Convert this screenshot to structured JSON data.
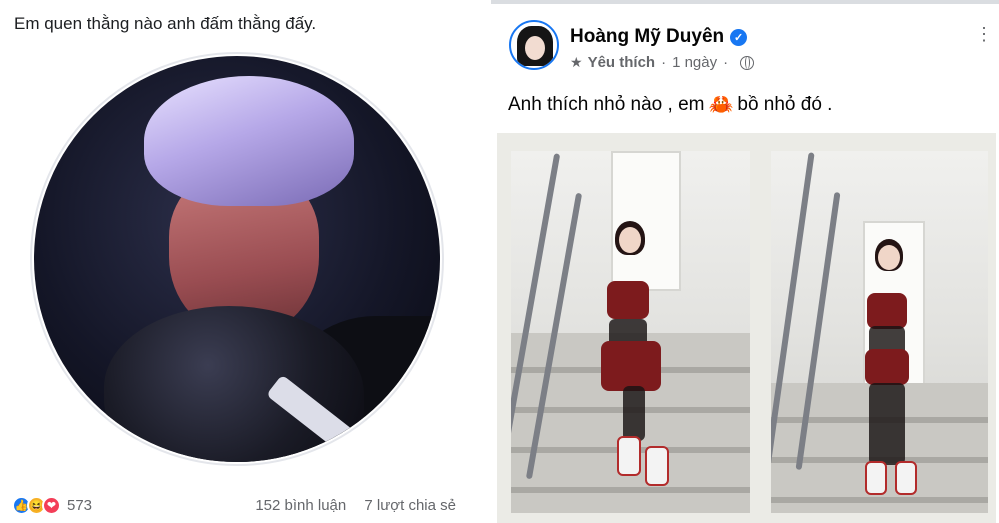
{
  "left_post": {
    "caption": "Em quen thằng nào anh đấm thằng đấy.",
    "reactions": {
      "icons": [
        "like-icon",
        "haha-icon",
        "love-icon"
      ],
      "count": "573"
    },
    "comments": "152 bình luận",
    "shares": "7 lượt chia sẻ"
  },
  "right_post": {
    "author": "Hoàng Mỹ Duyên",
    "meta": {
      "label": "Yêu thích",
      "time": "1 ngày"
    },
    "caption_before": "Anh thích nhỏ nào , em",
    "caption_after": "bồ nhỏ đó .",
    "caption_emoji": "crab-icon"
  },
  "colors": {
    "facebook_blue": "#1877f2",
    "secondary_text": "#65676b",
    "dress_red": "#7d1b1d"
  }
}
